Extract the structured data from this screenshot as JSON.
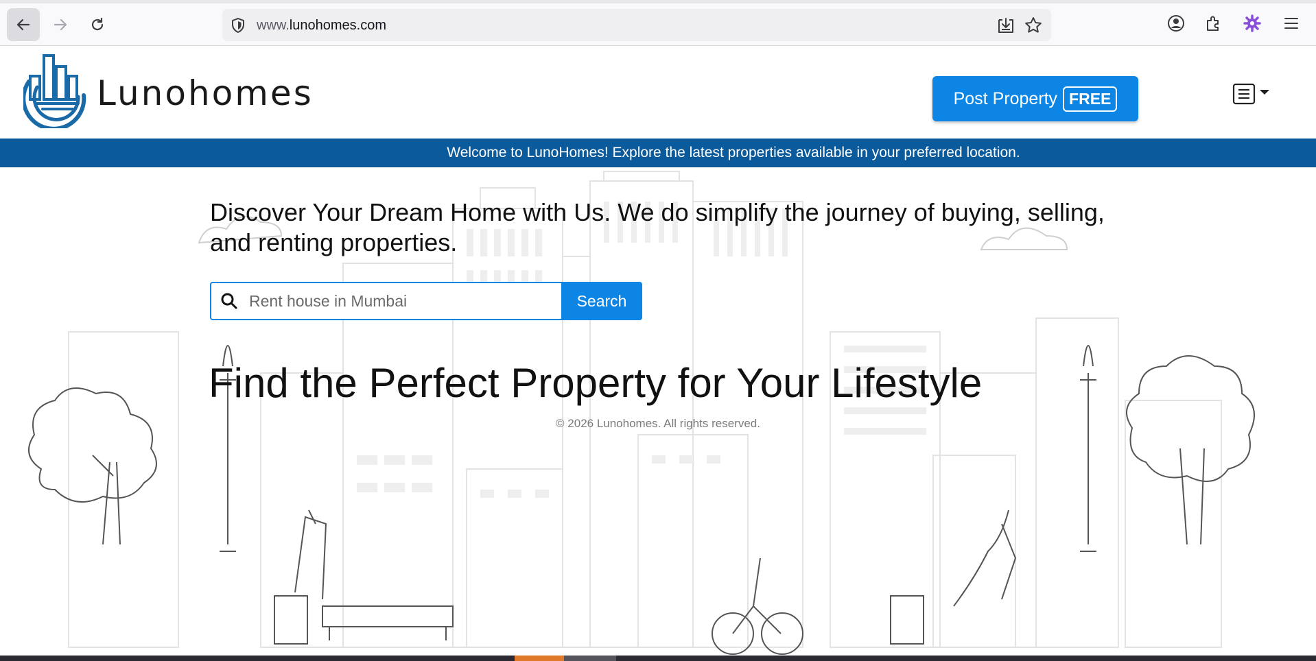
{
  "browser": {
    "url_prefix": "www.",
    "url_domain": "lunohomes.com"
  },
  "header": {
    "logo_text": "Lunohomes",
    "post_button_label": "Post Property",
    "post_button_badge": "FREE"
  },
  "banner": {
    "text": "Welcome to LunoHomes! Explore the latest properties available in your preferred location."
  },
  "hero": {
    "tagline": "Discover Your Dream Home with Us. We do simplify the journey of buying, selling, and renting properties.",
    "search_placeholder": "Rent house in Mumbai",
    "search_button_label": "Search",
    "title": "Find the Perfect Property for Your Lifestyle",
    "copyright": "© 2026 Lunohomes. All rights reserved."
  },
  "colors": {
    "brand_blue": "#0d85e5",
    "banner_blue": "#0b5a9c",
    "logo_blue": "#1a6aa8"
  },
  "icons": [
    "back-arrow-icon",
    "forward-arrow-icon",
    "reload-icon",
    "shield-icon",
    "download-icon",
    "star-icon",
    "account-icon",
    "extensions-icon",
    "extension-gear-icon",
    "hamburger-icon",
    "search-icon",
    "list-menu-icon"
  ]
}
